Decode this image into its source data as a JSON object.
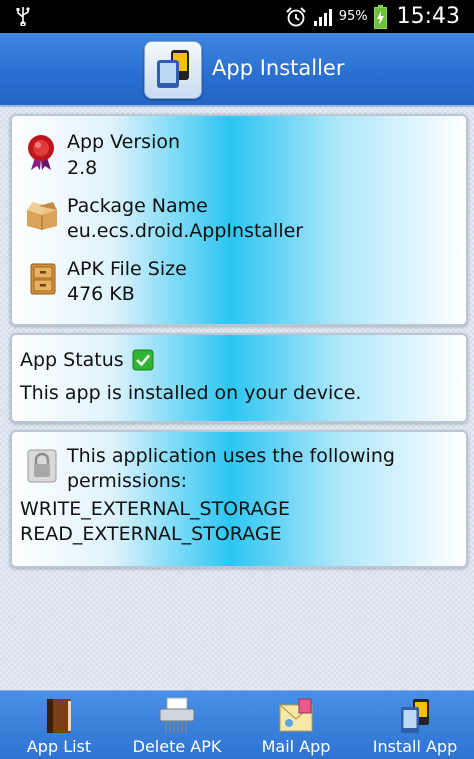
{
  "status_bar": {
    "battery_percent": "95%",
    "time": "15:43"
  },
  "header": {
    "title": "App Installer"
  },
  "app_info": {
    "version_label": "App Version",
    "version_value": "2.8",
    "package_label": "Package Name",
    "package_value": "eu.ecs.droid.AppInstaller",
    "size_label": "APK File Size",
    "size_value": "476 KB"
  },
  "status_card": {
    "label": "App Status",
    "message": "This app is installed on your device."
  },
  "permissions_card": {
    "intro_line1": "This application uses the following",
    "intro_line2": "permissions:",
    "permissions": [
      "WRITE_EXTERNAL_STORAGE",
      "READ_EXTERNAL_STORAGE"
    ]
  },
  "bottom_nav": {
    "items": [
      {
        "label": "App List",
        "icon": "book-icon"
      },
      {
        "label": "Delete APK",
        "icon": "shredder-icon"
      },
      {
        "label": "Mail App",
        "icon": "mail-icon"
      },
      {
        "label": "Install App",
        "icon": "install-icon"
      }
    ]
  },
  "colors": {
    "header": "#2a6fd0",
    "card_accent": "#2cc6f2",
    "bottom_bar": "#3a82dc",
    "status_ok": "#2fb52f"
  }
}
